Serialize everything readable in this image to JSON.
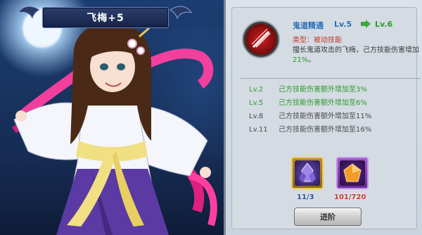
{
  "character": {
    "name": "飞梅+5"
  },
  "skill": {
    "name": "鬼道精通",
    "level": "Lv.5",
    "next_level": "Lv.6",
    "type": "类型：被动技能",
    "desc_prefix": "擅长鬼道攻击的飞梅，己方技能伤害增加",
    "desc_value": "21%",
    "desc_suffix": "。",
    "icon": "sword-slash-icon"
  },
  "levels": [
    {
      "lv": "Lv.2",
      "text": "己方技能伤害额外增加至3%",
      "active": true
    },
    {
      "lv": "Lv.5",
      "text": "己方技能伤害额外增加至6%",
      "active": true
    },
    {
      "lv": "Lv.8",
      "text": "己方技能伤害额外增加至11%",
      "active": false
    },
    {
      "lv": "Lv.11",
      "text": "己方技能伤害额外增加至16%",
      "active": false
    }
  ],
  "materials": [
    {
      "name": "crystal",
      "count": "11/3",
      "icon": "purple-crystal-icon"
    },
    {
      "name": "orb",
      "count": "101/720",
      "icon": "orange-gem-icon"
    }
  ],
  "buttons": {
    "advance": "进阶"
  },
  "colors": {
    "skill_name": "#2a6fb7",
    "active_level": "#2e9a2e",
    "type_text": "#c0392b"
  }
}
